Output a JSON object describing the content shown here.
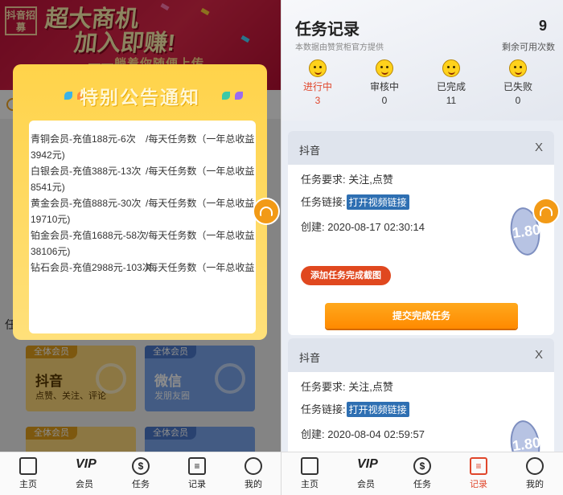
{
  "left": {
    "banner": {
      "logo_text": "抖音招募",
      "slogan_line1": "超大商机",
      "slogan_line2": "加入即赚!",
      "slogan_sub": "——躺着你随便上传"
    },
    "section_label": "任",
    "cards": [
      {
        "badge": "全体会员",
        "title": "抖音",
        "desc": "点赞、关注、评论"
      },
      {
        "badge": "全体会员",
        "title": "微信",
        "desc": "发朋友圈"
      },
      {
        "badge": "全体会员",
        "title": "",
        "desc": ""
      },
      {
        "badge": "全体会员",
        "title": "",
        "desc": ""
      }
    ],
    "modal": {
      "title": "特别公告通知",
      "close_symbol": "×",
      "lines": [
        {
          "a": "青铜会员-充值188元-6次",
          "b": "/每天任务数（一年总收益",
          "c": "3942元)"
        },
        {
          "a": "白银会员-充值388元-13次",
          "b": "/每天任务数（一年总收益",
          "c": "8541元)"
        },
        {
          "a": "黄金会员-充值888元-30次",
          "b": "/每天任务数（一年总收益",
          "c": "19710元)"
        },
        {
          "a": "铂金会员-充值1688元-58次",
          "b": "/每天任务数（一年总收益",
          "c": "38106元)"
        },
        {
          "a": "钻石会员-充值2988元-103次",
          "b": "/每天任务数（一年总收益",
          "c": ""
        }
      ]
    },
    "tabbar": [
      {
        "label": "主页",
        "icon": "grid-icon",
        "glyph": ""
      },
      {
        "label": "会员",
        "icon": "vip-icon",
        "glyph": "VIP"
      },
      {
        "label": "任务",
        "icon": "money-bag-icon",
        "glyph": "$"
      },
      {
        "label": "记录",
        "icon": "document-icon",
        "glyph": "≡"
      },
      {
        "label": "我的",
        "icon": "user-icon",
        "glyph": ""
      }
    ]
  },
  "right": {
    "title": "任务记录",
    "subtitle": "本数据由赞赏柜官方提供",
    "remaining_count": "9",
    "remaining_label": "剩余可用次数",
    "stats": [
      {
        "label": "进行中",
        "count": "3"
      },
      {
        "label": "审核中",
        "count": "0"
      },
      {
        "label": "已完成",
        "count": "11"
      },
      {
        "label": "已失败",
        "count": "0"
      }
    ],
    "tasks": [
      {
        "platform": "抖音",
        "close": "X",
        "requirement_label": "任务要求:",
        "requirement_value": "关注,点赞",
        "link_label": "任务链接:",
        "link_button": "打开视频链接",
        "created_label": "创建:",
        "created_value": "2020-08-17 02:30:14",
        "stamp": "1.80",
        "upload_button": "添加任务完成截图",
        "submit_button": "提交完成任务"
      },
      {
        "platform": "抖音",
        "close": "X",
        "requirement_label": "任务要求:",
        "requirement_value": "关注,点赞",
        "link_label": "任务链接:",
        "link_button": "打开视频链接",
        "created_label": "创建:",
        "created_value": "2020-08-04 02:59:57",
        "stamp": "1.80"
      }
    ],
    "tabbar": [
      {
        "label": "主页",
        "icon": "grid-icon",
        "glyph": ""
      },
      {
        "label": "会员",
        "icon": "vip-icon",
        "glyph": "VIP"
      },
      {
        "label": "任务",
        "icon": "money-bag-icon",
        "glyph": "$"
      },
      {
        "label": "记录",
        "icon": "document-icon",
        "glyph": "≡"
      },
      {
        "label": "我的",
        "icon": "user-icon",
        "glyph": ""
      }
    ],
    "active_tab": "记录"
  },
  "colors": {
    "accent_orange": "#ff8a00",
    "active_red": "#e0462b",
    "modal_yellow": "#ffd34a",
    "link_blue": "#2e6fb2"
  }
}
